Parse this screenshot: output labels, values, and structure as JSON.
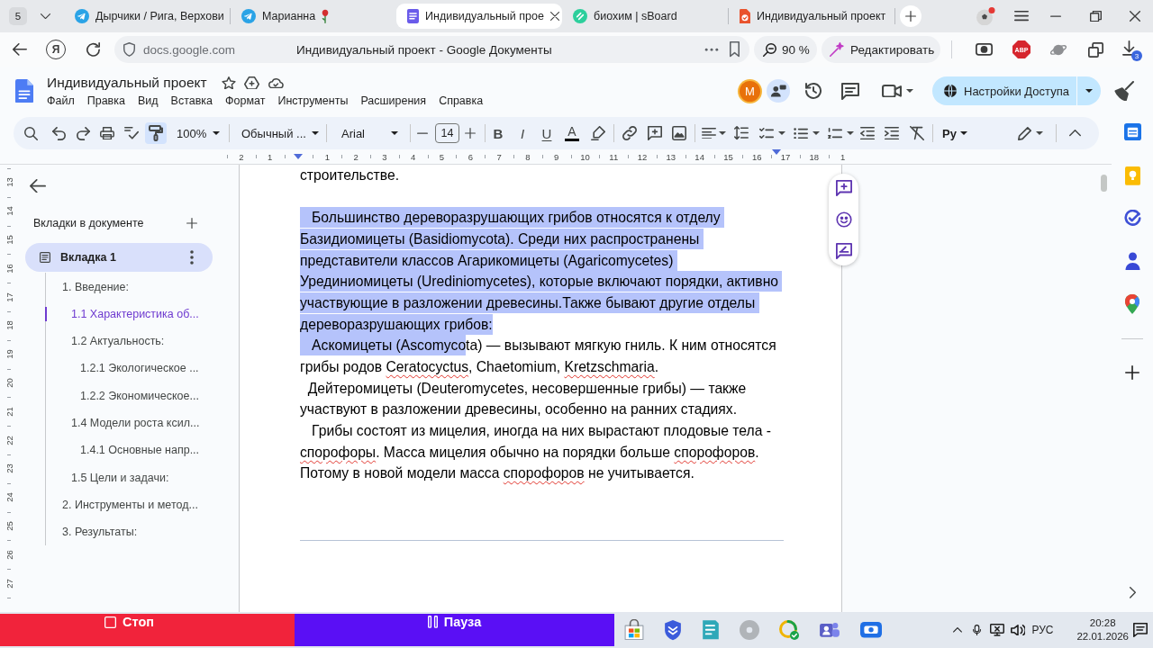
{
  "browser": {
    "tab_count": "5",
    "tabs": [
      {
        "title": "Дырчики / Рига, Верхови",
        "kind": "telegram",
        "trailing_emoji": false,
        "selected": false
      },
      {
        "title": "Марианна",
        "kind": "telegram",
        "trailing_emoji": true,
        "selected": false
      },
      {
        "title": "Индивидуальный прое",
        "kind": "docs",
        "trailing_emoji": false,
        "selected": true
      },
      {
        "title": "биохим | sBoard",
        "kind": "sboard",
        "trailing_emoji": false,
        "selected": false
      },
      {
        "title": "Индивидуальный проект",
        "kind": "doccheck",
        "trailing_emoji": false,
        "selected": false
      }
    ],
    "address": {
      "home_glyph": "Я",
      "host": "docs.google.com",
      "page_title": "Индивидуальный проект - Google Документы",
      "zoom": "90 %",
      "edit_button": "Редактировать",
      "adblock_label": "ABP",
      "downloads_count": "3"
    }
  },
  "docs": {
    "title": "Индивидуальный проект",
    "menu": [
      "Файл",
      "Правка",
      "Вид",
      "Вставка",
      "Формат",
      "Инструменты",
      "Расширения",
      "Справка"
    ],
    "avatar_letter": "M",
    "share_button": "Настройки Доступа",
    "toolbar": {
      "paint_format": {
        "selected": true
      },
      "zoom": "100%",
      "style": "Обычный ...",
      "font": "Arial",
      "font_size": "14",
      "bold": "B",
      "italic": "I",
      "underline": "U",
      "text_color": "A",
      "input_tools": "Ру"
    },
    "ruler": {
      "horizontal": [
        {
          "kind": "number",
          "label": "2"
        },
        {
          "kind": "number",
          "label": "1"
        },
        {
          "kind": "marker"
        },
        {
          "kind": "number",
          "label": "1"
        },
        {
          "kind": "number",
          "label": "2"
        },
        {
          "kind": "number",
          "label": "3"
        },
        {
          "kind": "number",
          "label": "4"
        },
        {
          "kind": "number",
          "label": "5"
        },
        {
          "kind": "number",
          "label": "6"
        },
        {
          "kind": "number",
          "label": "7"
        },
        {
          "kind": "number",
          "label": "8"
        },
        {
          "kind": "number",
          "label": "9"
        },
        {
          "kind": "number",
          "label": "10"
        },
        {
          "kind": "number",
          "label": "11"
        },
        {
          "kind": "number",
          "label": "12"
        },
        {
          "kind": "number",
          "label": "13"
        },
        {
          "kind": "number",
          "label": "14"
        },
        {
          "kind": "number",
          "label": "15"
        },
        {
          "kind": "number",
          "label": "16"
        },
        {
          "kind": "number",
          "label": "17"
        },
        {
          "kind": "number",
          "label": "18"
        },
        {
          "kind": "number",
          "label": "1"
        }
      ],
      "vertical": [
        "13",
        "14",
        "15",
        "16",
        "17",
        "18",
        "19",
        "20",
        "21",
        "22",
        "23",
        "24",
        "25",
        "26",
        "27"
      ]
    },
    "sidebar": {
      "heading": "Вкладки в документе",
      "tab": {
        "label": "Вкладка 1",
        "selected": true
      },
      "outline": [
        {
          "label": "1. Введение:",
          "selected": false,
          "children": [
            {
              "label": "1.1 Характеристика об...",
              "selected": true
            },
            {
              "label": "1.2 Актуальность:",
              "selected": false,
              "children": [
                {
                  "label": "1.2.1 Экологическое ...",
                  "selected": false
                },
                {
                  "label": "1.2.2 Экономическое...",
                  "selected": false
                }
              ]
            },
            {
              "label": "1.4 Модели роста ксил...",
              "selected": false,
              "children": [
                {
                  "label": "1.4.1 Основные напр...",
                  "selected": false
                }
              ]
            },
            {
              "label": "1.5 Цели и задачи:",
              "selected": false
            }
          ]
        },
        {
          "label": "2. Инструменты и метод...",
          "selected": false
        },
        {
          "label": "3. Результаты:",
          "selected": false
        }
      ]
    },
    "paragraphs": [
      {
        "kind": "text",
        "segments": [
          {
            "text": "строительстве.",
            "kind": "plain"
          }
        ]
      },
      {
        "kind": "empty"
      },
      {
        "kind": "text",
        "segments": [
          {
            "text": "   Большинство дереворазрушающих грибов относятся к отделу Базидиомицеты (Basidiomycota). Среди них распространены представители классов Агарикомицеты (Agaricomycetes) Урединиомицеты (Urediniomycetes), которые включают порядки, активно участвующие в разложении древесины.Также бывают другие отделы дереворазрушающих грибов:",
            "kind": "selected"
          }
        ]
      },
      {
        "kind": "text",
        "segments": [
          {
            "text": "   Аскомицеты (Ascomyco",
            "kind": "selected"
          },
          {
            "text": "ta) — вызывают мягкую гниль. К ним относятся грибы родов ",
            "kind": "plain"
          },
          {
            "text": "Ceratocyctus",
            "kind": "misspelled"
          },
          {
            "text": ", Chaetomium, ",
            "kind": "plain"
          },
          {
            "text": "Kretzschmaria",
            "kind": "misspelled"
          },
          {
            "text": ".",
            "kind": "plain"
          }
        ]
      },
      {
        "kind": "text",
        "segments": [
          {
            "text": "  Дейтеромицеты (Deuteromycetes, несовершенные грибы) — также участвуют в разложении древесины, особенно на ранних стадиях.",
            "kind": "plain"
          }
        ]
      },
      {
        "kind": "text",
        "segments": [
          {
            "text": "   Грибы состоят из мицелия, иногда на них вырастают плодовые тела - ",
            "kind": "plain"
          },
          {
            "text": "спорофоры",
            "kind": "misspelled"
          },
          {
            "text": ". Масса мицелия обычно на порядки больше ",
            "kind": "plain"
          },
          {
            "text": "спорофоров",
            "kind": "misspelled"
          },
          {
            "text": ". Потому в новой модели масса ",
            "kind": "plain"
          },
          {
            "text": "спорофоров",
            "kind": "misspelled"
          },
          {
            "text": " не учитывается.",
            "kind": "plain"
          }
        ]
      }
    ]
  },
  "taskbar": {
    "recorder": {
      "stop": "Стоп",
      "pause": "Пауза"
    },
    "language": "РУС",
    "time": "20:28",
    "date": "22.01.2026"
  }
}
